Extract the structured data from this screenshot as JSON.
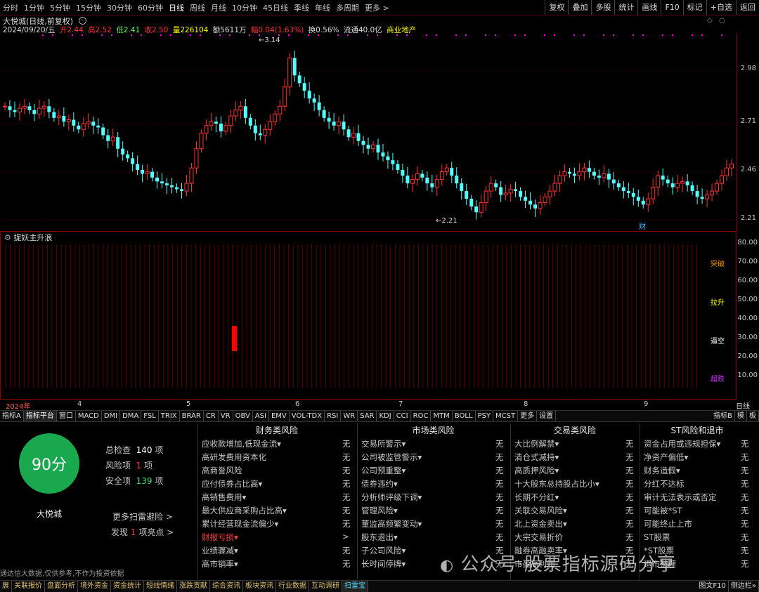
{
  "toolbar": {
    "periods": [
      "分时",
      "1分钟",
      "5分钟",
      "15分钟",
      "30分钟",
      "60分钟",
      "日线",
      "周线",
      "月线",
      "10分钟",
      "45日线",
      "季线",
      "年线",
      "多周期",
      "更多 >"
    ],
    "active_period": "日线",
    "right_buttons": [
      "复权",
      "叠加",
      "多股",
      "统计",
      "画线",
      "F10",
      "标记",
      "+自选",
      "返回"
    ]
  },
  "chart": {
    "title": "大悦城(日线,前复权)",
    "info": {
      "date": "2024/09/20/五",
      "open": "开2.44",
      "high": "高2.52",
      "low": "低2.41",
      "close": "收2.50",
      "volume": "量226104",
      "amount": "额5611万",
      "change": "幅0.04(1.63%)",
      "turnover": "换0.56%",
      "float": "流通40.0亿",
      "industry": "商业地产"
    },
    "price_axis": [
      "2.98",
      "2.71",
      "2.46",
      "2.21"
    ],
    "high_label": "3.14",
    "low_label": "2.21",
    "cai_label": "财"
  },
  "indicator": {
    "name": "捉妖主升浪",
    "axis": [
      "80.00",
      "70.00",
      "60.00",
      "50.00",
      "40.00",
      "30.00",
      "20.00",
      "10.00"
    ],
    "labels": [
      "突破",
      "拉升",
      "逼空",
      "超跌"
    ],
    "label_colors": [
      "#ff9900",
      "#ffff00",
      "#ffffff",
      "#cc33ff"
    ]
  },
  "dates": [
    "2024年",
    "4",
    "5",
    "6",
    "7",
    "8",
    "9"
  ],
  "period_label": "日线",
  "tabs": [
    "指标A",
    "指标平台",
    "窗口",
    "MACD",
    "DMI",
    "DMA",
    "FSL",
    "TRIX",
    "BRAR",
    "CR",
    "VR",
    "OBV",
    "ASI",
    "EMV",
    "VOL-TDX",
    "RSI",
    "WR",
    "SAR",
    "KDJ",
    "CCI",
    "ROC",
    "MTM",
    "BOLL",
    "PSY",
    "MCST",
    "更多",
    "设置"
  ],
  "tabs_right": [
    "指标B",
    "模",
    "板"
  ],
  "scan": {
    "score": "90分",
    "stock_name": "大悦城",
    "total_label": "总检查",
    "total": "140",
    "total_unit": "项",
    "risk_label": "风险项",
    "risk": "1",
    "risk_unit": "项",
    "safe_label": "安全项",
    "safe": "139",
    "safe_unit": "项",
    "more_link": "更多扫雷避险 >",
    "find_prefix": "发现",
    "find_count": "1",
    "find_suffix": "项亮点 >",
    "disclaimer": "通达信大数据,仅供参考,不作为投资依据",
    "columns": [
      {
        "title": "财务类风险",
        "rows": [
          {
            "label": "应收款增加,低现金流▾",
            "value": "无"
          },
          {
            "label": "高研发费用资本化",
            "value": "无"
          },
          {
            "label": "高商誉风险",
            "value": "无"
          },
          {
            "label": "应付债券占比高▾",
            "value": "无"
          },
          {
            "label": "高销售费用▾",
            "value": "无"
          },
          {
            "label": "最大供应商采购占比高▾",
            "value": "无"
          },
          {
            "label": "累计经营现金流偏少▾",
            "value": "无"
          },
          {
            "label": "财报亏损▾",
            "value": ">",
            "alert": true
          },
          {
            "label": "业绩骤减▾",
            "value": "无"
          },
          {
            "label": "高市销率▾",
            "value": "无"
          }
        ]
      },
      {
        "title": "市场类风险",
        "rows": [
          {
            "label": "交易所警示▾",
            "value": "无"
          },
          {
            "label": "公司被监管警示▾",
            "value": "无"
          },
          {
            "label": "公司预重整▾",
            "value": "无"
          },
          {
            "label": "债券违约▾",
            "value": "无"
          },
          {
            "label": "分析师评级下调▾",
            "value": "无"
          },
          {
            "label": "管理风险▾",
            "value": "无"
          },
          {
            "label": "董监高频繁变动▾",
            "value": "无"
          },
          {
            "label": "股东退出▾",
            "value": "无"
          },
          {
            "label": "子公司风险▾",
            "value": "无"
          },
          {
            "label": "长时间停牌▾",
            "value": "无"
          }
        ]
      },
      {
        "title": "交易类风险",
        "rows": [
          {
            "label": "大比例解禁▾",
            "value": "无"
          },
          {
            "label": "清仓式减持▾",
            "value": "无"
          },
          {
            "label": "高质押风险▾",
            "value": "无"
          },
          {
            "label": "十大股东总持股占比小▾",
            "value": "无"
          },
          {
            "label": "长期不分红▾",
            "value": "无"
          },
          {
            "label": "关联交易风险▾",
            "value": "无"
          },
          {
            "label": "北上资金卖出▾",
            "value": "无"
          },
          {
            "label": "大宗交易折价",
            "value": "无"
          },
          {
            "label": "融券高融卖率▾",
            "value": "无"
          },
          {
            "label": "市盈高利润",
            "value": "无"
          }
        ]
      },
      {
        "title": "ST风险和退市",
        "rows": [
          {
            "label": "资金占用或违规担保▾",
            "value": "无"
          },
          {
            "label": "净资产偏低▾",
            "value": "无"
          },
          {
            "label": "财务造假▾",
            "value": "无"
          },
          {
            "label": "分红不达标",
            "value": "无"
          },
          {
            "label": "审计无法表示或否定",
            "value": "无"
          },
          {
            "label": "可能被*ST",
            "value": "无"
          },
          {
            "label": "可能终止上市",
            "value": "无"
          },
          {
            "label": "ST股票",
            "value": "无"
          },
          {
            "label": "*ST股票",
            "value": "无"
          },
          {
            "label": "退市整理",
            "value": "无"
          }
        ]
      }
    ]
  },
  "statusbar": [
    "展",
    "关联报价",
    "盘面分析",
    "境外资金",
    "资金统计",
    "短线情绪",
    "涨跌贡献",
    "综合资讯",
    "板块资讯",
    "行业数据",
    "互动调研",
    "扫雷宝"
  ],
  "statusbar_selected": "扫雷宝",
  "statusbar_right": [
    "图文F10",
    "侧边栏»"
  ],
  "watermark": "公众号·股票指标源码分享",
  "colors": {
    "up": "#ff3232",
    "down": "#54ffff",
    "grid": "#8b0000",
    "magenta": "#ff00ff"
  }
}
